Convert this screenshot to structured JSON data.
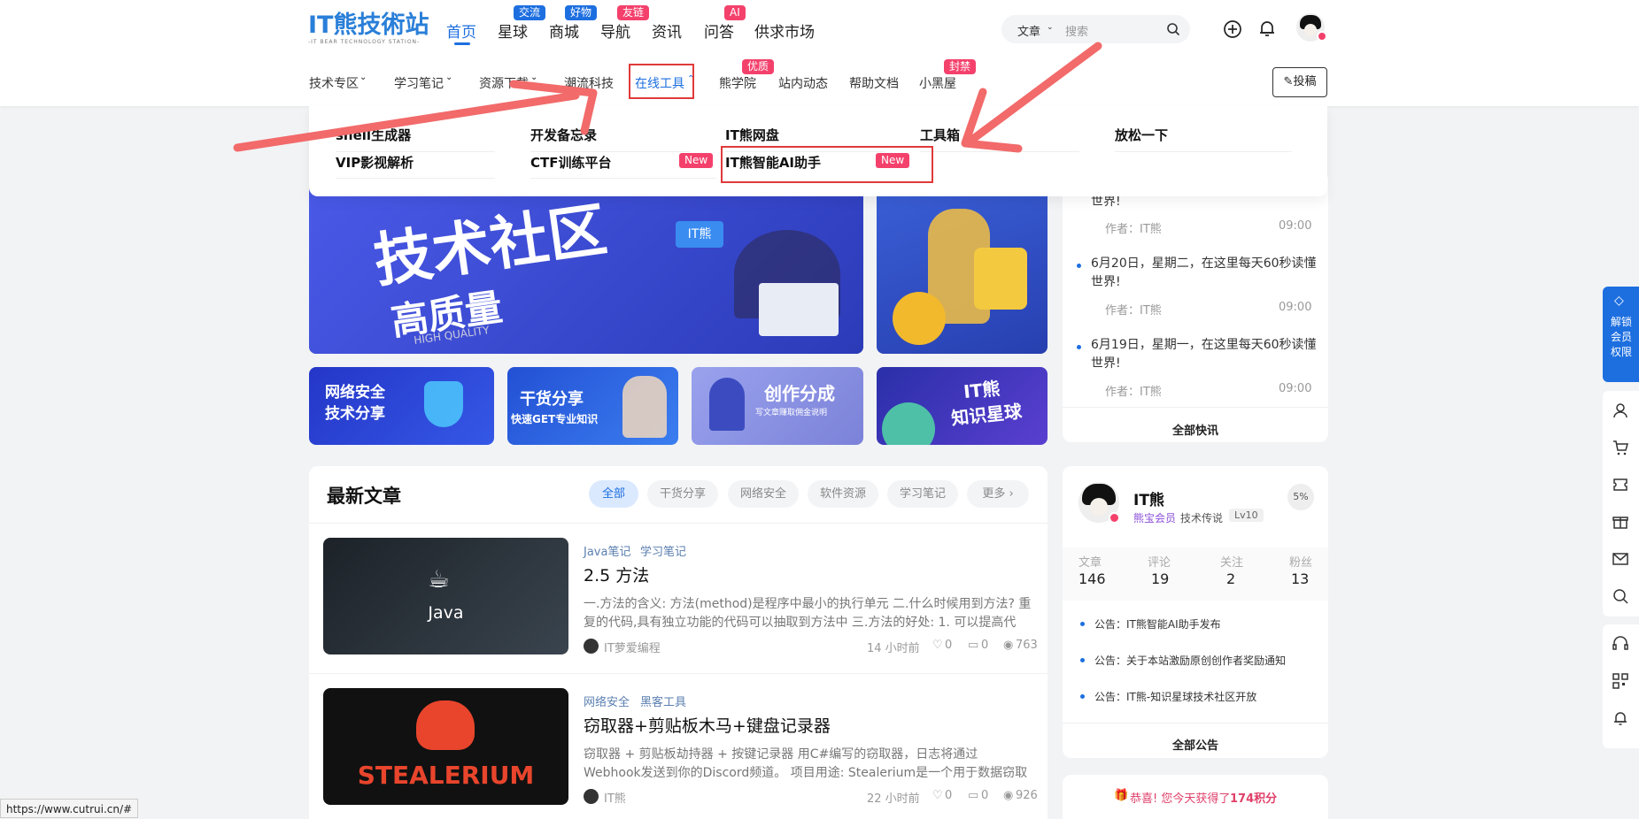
{
  "header": {
    "logo_text": "IT熊技術站",
    "logo_sub": "-IT BEAR TECHNOLOGY STATION-",
    "nav": [
      {
        "label": "首页",
        "badge": ""
      },
      {
        "label": "星球",
        "badge": "交流"
      },
      {
        "label": "商城",
        "badge": "好物"
      },
      {
        "label": "导航",
        "badge": "友链"
      },
      {
        "label": "资讯",
        "badge": ""
      },
      {
        "label": "问答",
        "badge": "AI"
      },
      {
        "label": "供求市场",
        "badge": ""
      }
    ],
    "search": {
      "category": "文章",
      "placeholder": "搜索"
    }
  },
  "subnav": {
    "items": [
      {
        "label": "技术专区",
        "badge": ""
      },
      {
        "label": "学习笔记",
        "badge": ""
      },
      {
        "label": "资源下载",
        "badge": ""
      },
      {
        "label": "潮流科技",
        "badge": ""
      },
      {
        "label": "在线工具",
        "badge": ""
      },
      {
        "label": "熊学院",
        "badge": "优质"
      },
      {
        "label": "站内动态",
        "badge": ""
      },
      {
        "label": "帮助文档",
        "badge": ""
      },
      {
        "label": "小黑屋",
        "badge": "封禁"
      }
    ],
    "post_label": "投稿"
  },
  "dropdown": {
    "items": [
      {
        "label": "shell生成器",
        "badge": ""
      },
      {
        "label": "开发备忘录",
        "badge": ""
      },
      {
        "label": "IT熊网盘",
        "badge": ""
      },
      {
        "label": "工具箱",
        "badge": ""
      },
      {
        "label": "放松一下",
        "badge": ""
      },
      {
        "label": "VIP影视解析",
        "badge": ""
      },
      {
        "label": "CTF训练平台",
        "badge": "New"
      },
      {
        "label": "IT熊智能AI助手",
        "badge": "New"
      }
    ]
  },
  "banners": {
    "main_text": "技术社区",
    "main_sub": "高质量",
    "main_eng": "HIGH QUALITY",
    "main_tag": "IT熊",
    "small": [
      {
        "title": "网络安全",
        "sub": "技术分享",
        "color": "#2b49d8"
      },
      {
        "title": "干货分享",
        "sub": "快速GET专业知识",
        "color": "#2b5fd8"
      },
      {
        "title": "创作分成",
        "sub": "写文章赚取佣金说明",
        "color": "#8a8fe0"
      },
      {
        "title": "IT熊",
        "sub": "知识星球",
        "color": "#3a3fb0"
      }
    ]
  },
  "news": {
    "top_partial": "世界!",
    "items": [
      {
        "text": "6月20日，星期二，在这里每天60秒读懂世界!",
        "author": "作者：IT熊",
        "time": "09:00"
      },
      {
        "text": "6月19日，星期一，在这里每天60秒读懂世界!",
        "author": "作者：IT熊",
        "time": "09:00"
      }
    ],
    "first_author": "作者：IT熊",
    "first_time": "09:00",
    "all_label": "全部快讯"
  },
  "articles": {
    "heading": "最新文章",
    "tabs": [
      "全部",
      "干货分享",
      "网络安全",
      "软件资源",
      "学习笔记",
      "更多 ›"
    ],
    "list": [
      {
        "tags": [
          "Java笔记",
          "学习笔记"
        ],
        "title": "2.5 方法",
        "desc": "一.方法的含义: 方法(method)是程序中最小的执行单元 二.什么时候用到方法? 重复的代码,具有独立功能的代码可以抽取到方法中 三.方法的好处: 1. 可以提高代码...",
        "author": "IT萝爱编程",
        "time": "14 小时前",
        "likes": "0",
        "comments": "0",
        "views": "763",
        "thumb": "Java"
      },
      {
        "tags": [
          "网络安全",
          "黑客工具"
        ],
        "title": "窃取器+剪贴板木马+键盘记录器",
        "desc": "窃取器 + 剪贴板劫持器 + 按键记录器 用C#编写的窃取器，日志将通过Webhook发送到你的Discord频道。 项目用途: Stealerium是一个用于数据窃取的工具，...",
        "author": "IT熊",
        "time": "22 小时前",
        "likes": "0",
        "comments": "0",
        "views": "926",
        "thumb": "STEALERIUM"
      }
    ]
  },
  "profile": {
    "name": "IT熊",
    "percent": "5%",
    "vip": "熊宝会员",
    "title": "技术传说",
    "level": "Lv10",
    "stats": [
      {
        "label": "文章",
        "value": "146"
      },
      {
        "label": "评论",
        "value": "19"
      },
      {
        "label": "关注",
        "value": "2"
      },
      {
        "label": "粉丝",
        "value": "13"
      }
    ],
    "notices": [
      "公告：IT熊智能AI助手发布",
      "公告：关于本站激励原创创作者奖励通知",
      "公告：IT熊-知识星球技术社区开放"
    ],
    "all_notices": "全部公告"
  },
  "bonus": {
    "text": "恭喜! 您今天获得了",
    "points": "174积分"
  },
  "sidebar_right": {
    "vip_label": "解锁会员权限"
  },
  "status_url": "https://www.cutrui.cn/#",
  "colors": {
    "accent": "#1d6fe0",
    "badge_red": "#f4416c",
    "badge_blue": "#1d6fe0",
    "highlight": "#e03a3a",
    "arrow": "#f26a6a"
  }
}
